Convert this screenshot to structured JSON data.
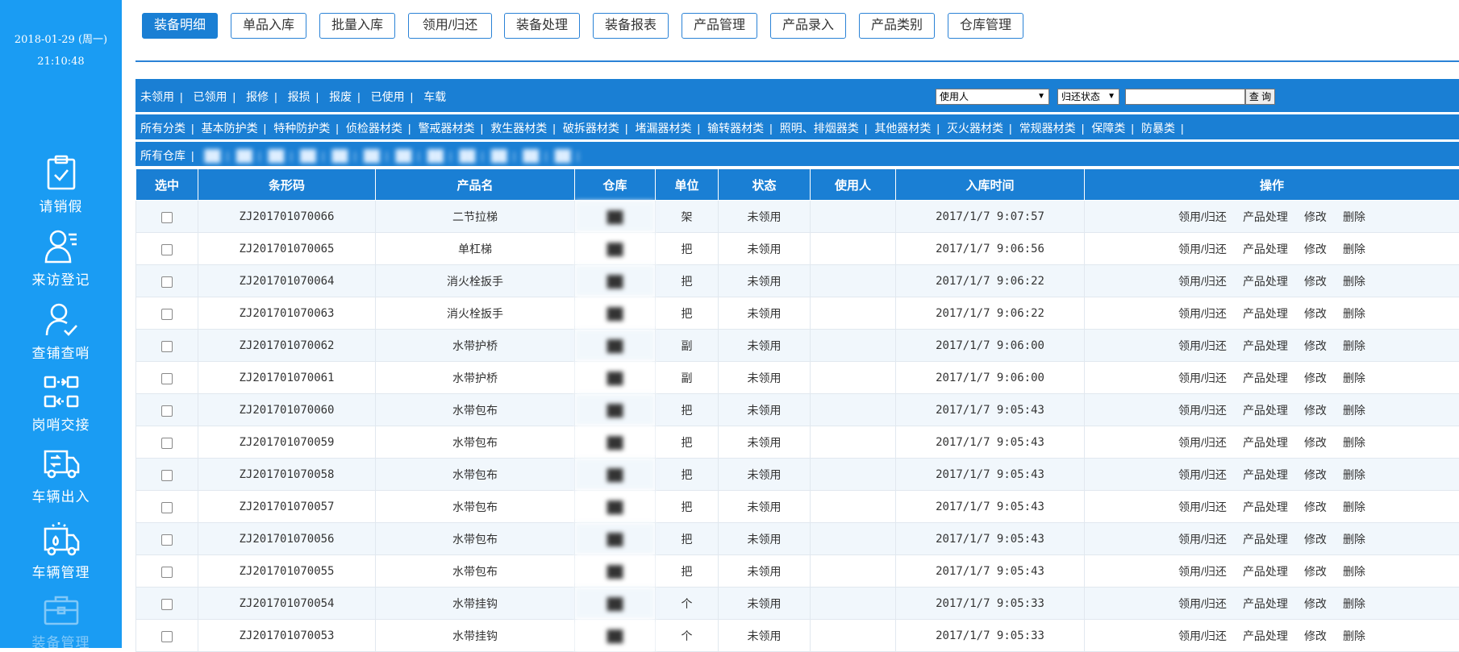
{
  "sidebar": {
    "date": "2018-01-29 (周一)",
    "time": "21:10:48",
    "items": [
      {
        "label": "请销假",
        "icon": "clipboard-check-icon"
      },
      {
        "label": "来访登记",
        "icon": "user-list-icon"
      },
      {
        "label": "查铺查哨",
        "icon": "user-check-icon"
      },
      {
        "label": "岗哨交接",
        "icon": "handover-icon"
      },
      {
        "label": "车辆出入",
        "icon": "truck-icon"
      },
      {
        "label": "车辆管理",
        "icon": "fire-truck-icon"
      },
      {
        "label": "装备管理",
        "icon": "toolbox-icon"
      }
    ]
  },
  "topnav": {
    "buttons": [
      "装备明细",
      "单品入库",
      "批量入库",
      "领用/归还",
      "装备处理",
      "装备报表",
      "产品管理",
      "产品录入",
      "产品类别",
      "仓库管理"
    ],
    "active": "装备明细"
  },
  "status_filters": [
    "未领用",
    "已领用",
    "报修",
    "报损",
    "报废",
    "已使用",
    "车载"
  ],
  "search": {
    "user_select": "使用人",
    "return_select": "归还状态",
    "input_value": "",
    "button": "查 询"
  },
  "categories": [
    "所有分类",
    "基本防护类",
    "特种防护类",
    "侦检器材类",
    "警戒器材类",
    "救生器材类",
    "破拆器材类",
    "堵漏器材类",
    "输转器材类",
    "照明、排烟器类",
    "其他器材类",
    "灭火器材类",
    "常规器材类",
    "保障类",
    "防暴类"
  ],
  "warehouses": {
    "label": "所有仓库",
    "names": [
      "██",
      "██",
      "██",
      "██",
      "██",
      "██",
      "██",
      "██",
      "██",
      "██",
      "██",
      "██"
    ]
  },
  "table": {
    "headers": [
      "选中",
      "条形码",
      "产品名",
      "仓库",
      "单位",
      "状态",
      "使用人",
      "入库时间",
      "操作"
    ],
    "actions": [
      "领用/归还",
      "产品处理",
      "修改",
      "删除"
    ],
    "warehouse_placeholder": "██",
    "rows": [
      {
        "code": "ZJ201701070066",
        "name": "二节拉梯",
        "unit": "架",
        "status": "未领用",
        "user": "",
        "time": "2017/1/7 9:07:57"
      },
      {
        "code": "ZJ201701070065",
        "name": "单杠梯",
        "unit": "把",
        "status": "未领用",
        "user": "",
        "time": "2017/1/7 9:06:56"
      },
      {
        "code": "ZJ201701070064",
        "name": "消火栓扳手",
        "unit": "把",
        "status": "未领用",
        "user": "",
        "time": "2017/1/7 9:06:22"
      },
      {
        "code": "ZJ201701070063",
        "name": "消火栓扳手",
        "unit": "把",
        "status": "未领用",
        "user": "",
        "time": "2017/1/7 9:06:22"
      },
      {
        "code": "ZJ201701070062",
        "name": "水带护桥",
        "unit": "副",
        "status": "未领用",
        "user": "",
        "time": "2017/1/7 9:06:00"
      },
      {
        "code": "ZJ201701070061",
        "name": "水带护桥",
        "unit": "副",
        "status": "未领用",
        "user": "",
        "time": "2017/1/7 9:06:00"
      },
      {
        "code": "ZJ201701070060",
        "name": "水带包布",
        "unit": "把",
        "status": "未领用",
        "user": "",
        "time": "2017/1/7 9:05:43"
      },
      {
        "code": "ZJ201701070059",
        "name": "水带包布",
        "unit": "把",
        "status": "未领用",
        "user": "",
        "time": "2017/1/7 9:05:43"
      },
      {
        "code": "ZJ201701070058",
        "name": "水带包布",
        "unit": "把",
        "status": "未领用",
        "user": "",
        "time": "2017/1/7 9:05:43"
      },
      {
        "code": "ZJ201701070057",
        "name": "水带包布",
        "unit": "把",
        "status": "未领用",
        "user": "",
        "time": "2017/1/7 9:05:43"
      },
      {
        "code": "ZJ201701070056",
        "name": "水带包布",
        "unit": "把",
        "status": "未领用",
        "user": "",
        "time": "2017/1/7 9:05:43"
      },
      {
        "code": "ZJ201701070055",
        "name": "水带包布",
        "unit": "把",
        "status": "未领用",
        "user": "",
        "time": "2017/1/7 9:05:43"
      },
      {
        "code": "ZJ201701070054",
        "name": "水带挂钩",
        "unit": "个",
        "status": "未领用",
        "user": "",
        "time": "2017/1/7 9:05:33"
      },
      {
        "code": "ZJ201701070053",
        "name": "水带挂钩",
        "unit": "个",
        "status": "未领用",
        "user": "",
        "time": "2017/1/7 9:05:33"
      }
    ]
  }
}
